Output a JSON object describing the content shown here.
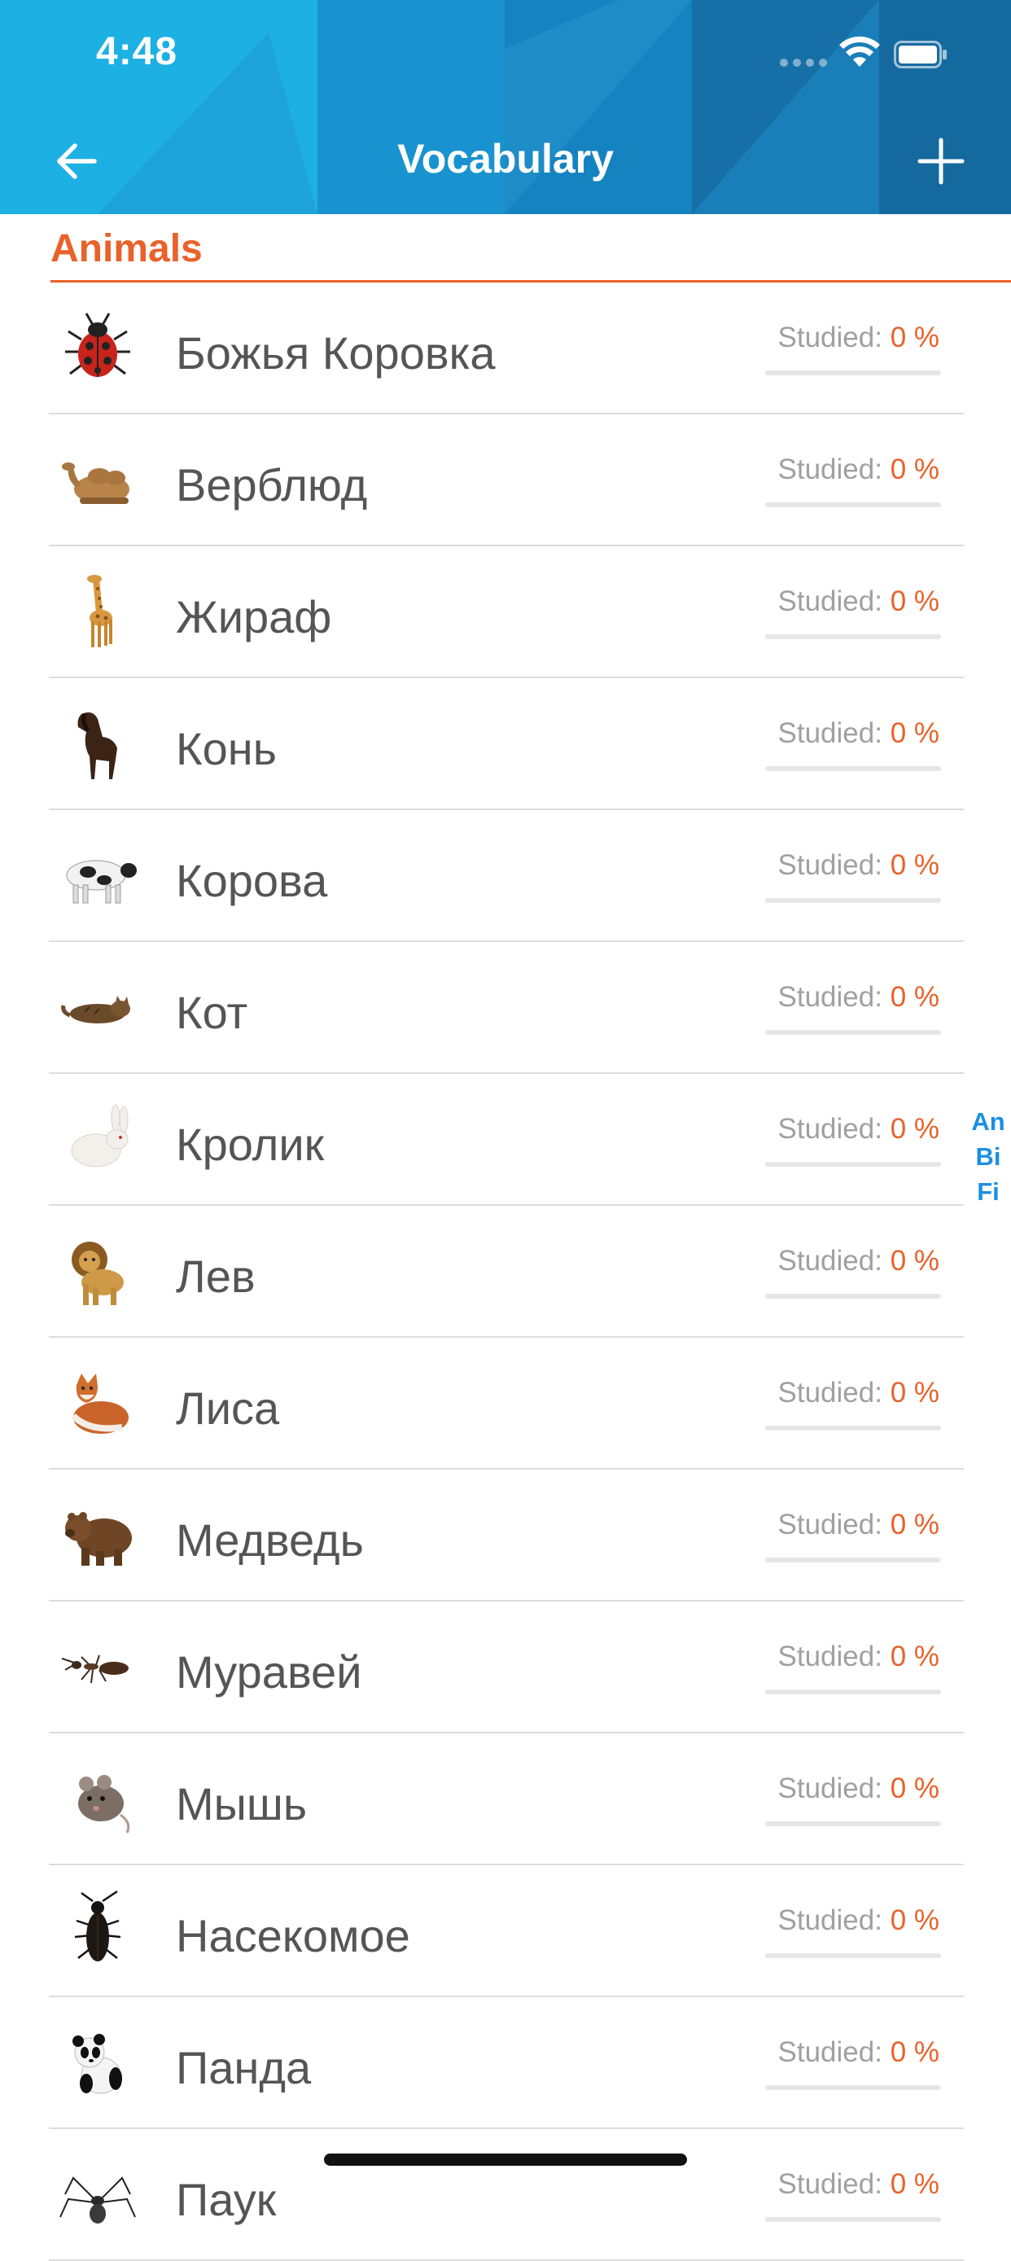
{
  "status_bar": {
    "time": "4:48"
  },
  "nav": {
    "title": "Vocabulary"
  },
  "section": {
    "title": "Animals"
  },
  "studied_label": "Studied:",
  "items": [
    {
      "word": "Божья Коровка",
      "percent": "0 %",
      "progress": 0,
      "icon": "ladybug-icon"
    },
    {
      "word": "Верблюд",
      "percent": "0 %",
      "progress": 0,
      "icon": "camel-icon"
    },
    {
      "word": "Жираф",
      "percent": "0 %",
      "progress": 0,
      "icon": "giraffe-icon"
    },
    {
      "word": "Конь",
      "percent": "0 %",
      "progress": 0,
      "icon": "horse-icon"
    },
    {
      "word": "Корова",
      "percent": "0 %",
      "progress": 0,
      "icon": "cow-icon"
    },
    {
      "word": "Кот",
      "percent": "0 %",
      "progress": 0,
      "icon": "cat-icon"
    },
    {
      "word": "Кролик",
      "percent": "0 %",
      "progress": 0,
      "icon": "rabbit-icon"
    },
    {
      "word": "Лев",
      "percent": "0 %",
      "progress": 0,
      "icon": "lion-icon"
    },
    {
      "word": "Лиса",
      "percent": "0 %",
      "progress": 0,
      "icon": "fox-icon"
    },
    {
      "word": "Медведь",
      "percent": "0 %",
      "progress": 0,
      "icon": "bear-icon"
    },
    {
      "word": "Муравей",
      "percent": "0 %",
      "progress": 0,
      "icon": "ant-icon"
    },
    {
      "word": "Мышь",
      "percent": "0 %",
      "progress": 0,
      "icon": "mouse-icon"
    },
    {
      "word": "Насекомое",
      "percent": "0 %",
      "progress": 0,
      "icon": "beetle-icon"
    },
    {
      "word": "Панда",
      "percent": "0 %",
      "progress": 0,
      "icon": "panda-icon"
    },
    {
      "word": "Паук",
      "percent": "0 %",
      "progress": 0,
      "icon": "spider-icon"
    }
  ],
  "index": [
    "An",
    "Bi",
    "Fi"
  ],
  "colors": {
    "header": "#1aa6dc",
    "accent": "#e8622a",
    "index": "#1a8fe3"
  }
}
